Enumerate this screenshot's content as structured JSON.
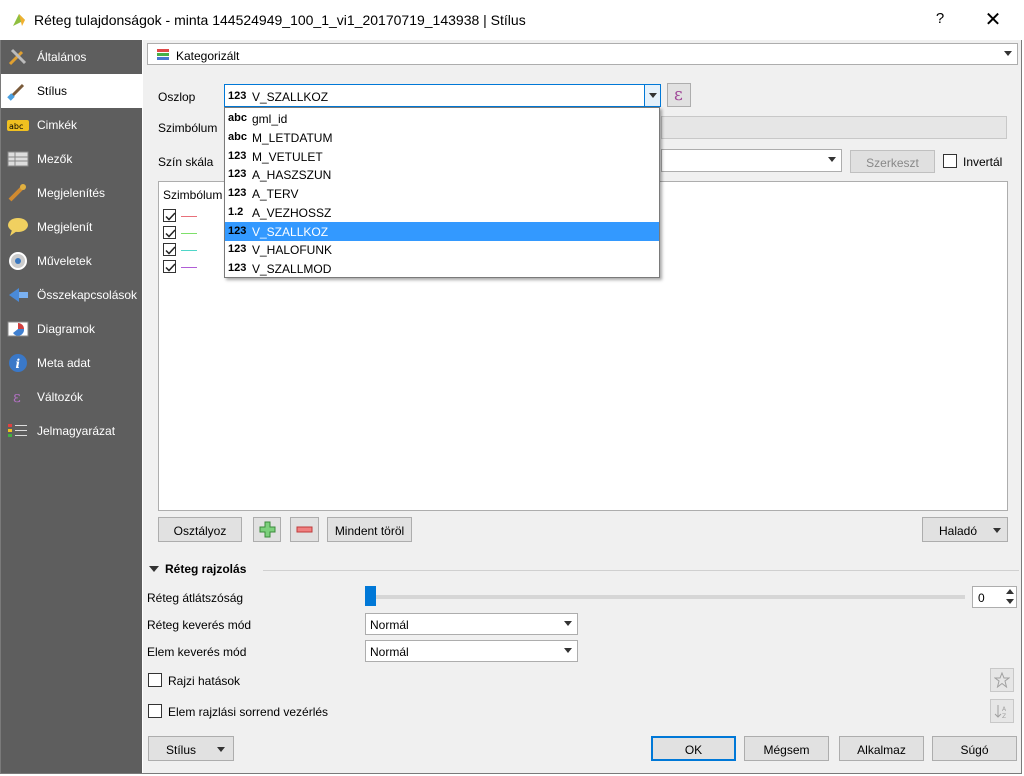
{
  "window": {
    "title": "Réteg tulajdonságok - minta 144524949_100_1_vi1_20170719_143938 | Stílus",
    "help_label": "?",
    "close_label": "✕"
  },
  "sidebar": {
    "items": [
      {
        "label": "Általános",
        "icon": "tools-icon"
      },
      {
        "label": "Stílus",
        "icon": "paintbrush-icon"
      },
      {
        "label": "Cimkék",
        "icon": "abc-label-icon"
      },
      {
        "label": "Mezők",
        "icon": "table-icon"
      },
      {
        "label": "Megjelenítés",
        "icon": "display-icon"
      },
      {
        "label": "Megjelenít",
        "icon": "speech-bubble-icon"
      },
      {
        "label": "Műveletek",
        "icon": "gear-icon"
      },
      {
        "label": "Összekapcsolások",
        "icon": "join-icon"
      },
      {
        "label": "Diagramok",
        "icon": "diagram-icon"
      },
      {
        "label": "Meta adat",
        "icon": "info-icon"
      },
      {
        "label": "Változók",
        "icon": "epsilon-icon"
      },
      {
        "label": "Jelmagyarázat",
        "icon": "legend-icon"
      }
    ]
  },
  "renderer": {
    "type_value": "Kategorizált"
  },
  "form": {
    "column_label": "Oszlop",
    "column_value_type": "123",
    "column_value": "V_SZALLKOZ",
    "symbol_label": "Szimbólum",
    "color_ramp_label": "Szín skála",
    "edit_label": "Szerkeszt",
    "invert_label": "Invertál"
  },
  "dropdown": {
    "items": [
      {
        "type": "abc",
        "name": "gml_id",
        "selected": false
      },
      {
        "type": "abc",
        "name": "M_LETDATUM",
        "selected": false
      },
      {
        "type": "123",
        "name": "M_VETULET",
        "selected": false
      },
      {
        "type": "123",
        "name": "A_HASZSZUN",
        "selected": false
      },
      {
        "type": "123",
        "name": "A_TERV",
        "selected": false
      },
      {
        "type": "1.2",
        "name": "A_VEZHOSSZ",
        "selected": false
      },
      {
        "type": "123",
        "name": "V_SZALLKOZ",
        "selected": true
      },
      {
        "type": "123",
        "name": "V_HALOFUNK",
        "selected": false
      },
      {
        "type": "123",
        "name": "V_SZALLMOD",
        "selected": false
      }
    ]
  },
  "list": {
    "header": "Szimbólum",
    "rows": [
      {
        "color": "#e8707a"
      },
      {
        "color": "#7ee06a"
      },
      {
        "color": "#4fd6c8"
      },
      {
        "color": "#b05ed6"
      }
    ]
  },
  "buttons": {
    "classify": "Osztályoz",
    "delete_all": "Mindent töröl",
    "advanced": "Haladó"
  },
  "layer_rendering": {
    "title": "Réteg rajzolás",
    "opacity_label": "Réteg átlátszóság",
    "opacity_value": "0",
    "blend_label": "Réteg keverés mód",
    "blend_value": "Normál",
    "feature_blend_label": "Elem keverés mód",
    "feature_blend_value": "Normál",
    "effects_label": "Rajzi hatások",
    "order_label": "Elem rajzlási sorrend vezérlés"
  },
  "footer": {
    "style": "Stílus",
    "ok": "OK",
    "cancel": "Mégsem",
    "apply": "Alkalmaz",
    "help": "Súgó"
  },
  "colors": {
    "sidebar_bg": "#5e5e5e",
    "selection": "#3399ff",
    "accent": "#0078d7"
  }
}
